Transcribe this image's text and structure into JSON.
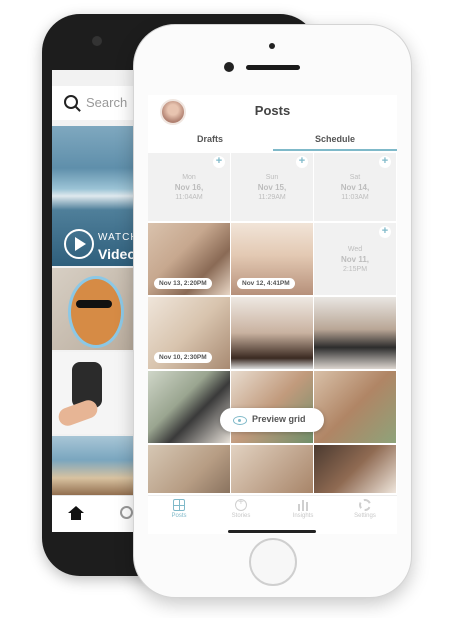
{
  "back_phone": {
    "search_placeholder": "Search",
    "watch_label": "WATCH",
    "video_label": "Video"
  },
  "app": {
    "title": "Posts",
    "accent_color": "#7fb9c9",
    "tabs": [
      {
        "label": "Drafts",
        "active": false
      },
      {
        "label": "Schedule",
        "active": true
      }
    ],
    "schedule_slots": [
      {
        "day": "Mon",
        "date": "Nov 16,",
        "time": "11:04AM"
      },
      {
        "day": "Sun",
        "date": "Nov 15,",
        "time": "11:29AM"
      },
      {
        "day": "Sat",
        "date": "Nov 14,",
        "time": "11:03AM"
      },
      {
        "day": "Wed",
        "date": "Nov 11,",
        "time": "2:15PM"
      }
    ],
    "scheduled_posts": [
      {
        "label": "Nov 13, 2:20PM"
      },
      {
        "label": "Nov 12, 4:41PM"
      },
      {
        "label": "Nov 10, 2:30PM"
      }
    ],
    "preview_button": "Preview grid",
    "nav": [
      {
        "label": "Posts",
        "icon": "grid-icon",
        "active": true
      },
      {
        "label": "Stories",
        "icon": "add-story-icon",
        "active": false
      },
      {
        "label": "Insights",
        "icon": "bar-chart-icon",
        "active": false
      },
      {
        "label": "Settings",
        "icon": "gear-icon",
        "active": false
      }
    ]
  }
}
